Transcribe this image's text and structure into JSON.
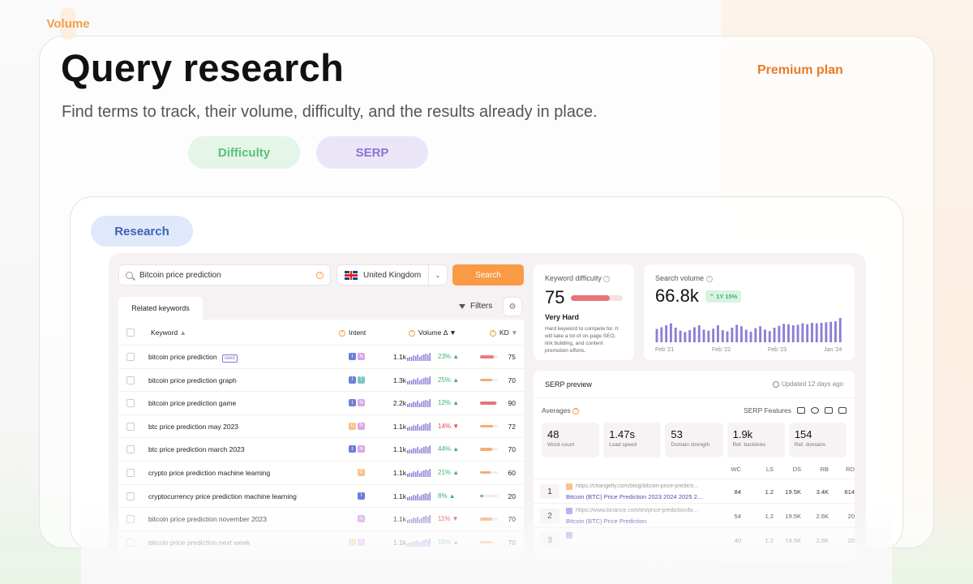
{
  "hero": {
    "title": "Query research",
    "plan": "Premium plan",
    "subtitle": "Find terms to track, their volume, difficulty, and the results already in place.",
    "pills": [
      "Volume",
      "Difficulty",
      "SERP"
    ],
    "section_pill": "Research"
  },
  "toolbar": {
    "search_value": "Bitcoin price prediction",
    "country": "United Kingdom",
    "search_button": "Search",
    "tab": "Related keywords",
    "filters": "Filters"
  },
  "table": {
    "headers": {
      "keyword": "Keyword",
      "intent": "Intent",
      "volume": "Volume Δ",
      "kd": "KD"
    },
    "seed_tag": "seed",
    "rows": [
      {
        "keyword": "bitcoin price prediction",
        "seed": true,
        "intents": [
          "I",
          "N"
        ],
        "volume": "1.1k",
        "delta": "23%",
        "dir": "up",
        "kd": "75",
        "kd_level": 0.75,
        "kd_color": "#ea7b80"
      },
      {
        "keyword": "bitcoin price prediction graph",
        "seed": false,
        "intents": [
          "I",
          "T"
        ],
        "volume": "1.3k",
        "delta": "25%",
        "dir": "up",
        "kd": "70",
        "kd_level": 0.7,
        "kd_color": "#f5ad78"
      },
      {
        "keyword": "bitcoin price prediction game",
        "seed": false,
        "intents": [
          "I",
          "N"
        ],
        "volume": "2.2k",
        "delta": "12%",
        "dir": "up",
        "kd": "90",
        "kd_level": 0.9,
        "kd_color": "#e5747b"
      },
      {
        "keyword": "btc price prediction may 2023",
        "seed": false,
        "intents": [
          "C",
          "N"
        ],
        "volume": "1.1k",
        "delta": "14%",
        "dir": "down",
        "kd": "72",
        "kd_level": 0.72,
        "kd_color": "#f5ad78"
      },
      {
        "keyword": "btc price prediction march 2023",
        "seed": false,
        "intents": [
          "I",
          "N"
        ],
        "volume": "1.1k",
        "delta": "44%",
        "dir": "up",
        "kd": "70",
        "kd_level": 0.7,
        "kd_color": "#f5ad78"
      },
      {
        "keyword": "crypto price prediction machine learning",
        "seed": false,
        "intents": [
          "C"
        ],
        "volume": "1.1k",
        "delta": "21%",
        "dir": "up",
        "kd": "60",
        "kd_level": 0.6,
        "kd_color": "#f5ad78"
      },
      {
        "keyword": "cryptocurrency price prediction machine learning",
        "seed": false,
        "intents": [
          "I"
        ],
        "volume": "1.1k",
        "delta": "8%",
        "dir": "up",
        "kd": "20",
        "kd_level": 0.2,
        "kd_color": "#58c27a"
      },
      {
        "keyword": "bitcoin price prediction november 2023",
        "seed": false,
        "intents": [
          "N"
        ],
        "volume": "1.1k",
        "delta": "11%",
        "dir": "down",
        "kd": "70",
        "kd_level": 0.7,
        "kd_color": "#f5ad78"
      },
      {
        "keyword": "bitcoin price prediction next week",
        "seed": false,
        "intents": [
          "C",
          "N"
        ],
        "volume": "1.1k",
        "delta": "15%",
        "dir": "up",
        "kd": "70",
        "kd_level": 0.7,
        "kd_color": "#f5ad78"
      }
    ]
  },
  "kd_card": {
    "label": "Keyword difficulty",
    "value": "75",
    "level": 0.75,
    "rating": "Very Hard",
    "description": "Hard keyword to compete for. It will take a lot of on-page SEO, link building, and content promotion efforts."
  },
  "volume_card": {
    "label": "Search volume",
    "value": "66.8k",
    "trend": "1Y 15%",
    "x_labels": [
      "Feb '21",
      "Feb '22",
      "Feb '23",
      "Jan '24"
    ],
    "bars": [
      0.55,
      0.62,
      0.7,
      0.78,
      0.6,
      0.48,
      0.42,
      0.5,
      0.62,
      0.7,
      0.52,
      0.48,
      0.56,
      0.7,
      0.5,
      0.45,
      0.6,
      0.72,
      0.66,
      0.52,
      0.44,
      0.58,
      0.66,
      0.52,
      0.46,
      0.6,
      0.68,
      0.76,
      0.74,
      0.7,
      0.72,
      0.78,
      0.74,
      0.8,
      0.78,
      0.8,
      0.82,
      0.84,
      0.86,
      1.0
    ]
  },
  "serp": {
    "title": "SERP preview",
    "updated": "Updated 12 days ago",
    "averages": "Averages",
    "features": "SERP Features",
    "stats": [
      {
        "value": "48",
        "label": "Word count"
      },
      {
        "value": "1.47s",
        "label": "Load speed"
      },
      {
        "value": "53",
        "label": "Domain strength"
      },
      {
        "value": "1.9k",
        "label": "Ref. backlinks"
      },
      {
        "value": "154",
        "label": "Ref. domains"
      }
    ],
    "columns": [
      "WC",
      "LS",
      "DS",
      "RB",
      "RD"
    ],
    "results": [
      {
        "rank": "1",
        "url": "https://changelly.com/blog/bitcoin-price-predicti...",
        "title": "Bitcoin (BTC) Price Prediction 2023 2024 2025 2...",
        "fav": "#f7c28c",
        "metrics": [
          "84",
          "1.2",
          "19.5K",
          "3.4K",
          "614"
        ]
      },
      {
        "rank": "2",
        "url": "https://www.binance.com/en/price-prediction/bi...",
        "title": "Bitcoin (BTC) Price Prediction",
        "fav": "#b7a6e6",
        "metrics": [
          "54",
          "1.2",
          "19.5K",
          "2.6K",
          "20"
        ]
      },
      {
        "rank": "3",
        "url": "",
        "title": "",
        "fav": "#9aa6ea",
        "metrics": [
          "40",
          "1.2",
          "19.5K",
          "2.6K",
          "20"
        ]
      }
    ]
  }
}
